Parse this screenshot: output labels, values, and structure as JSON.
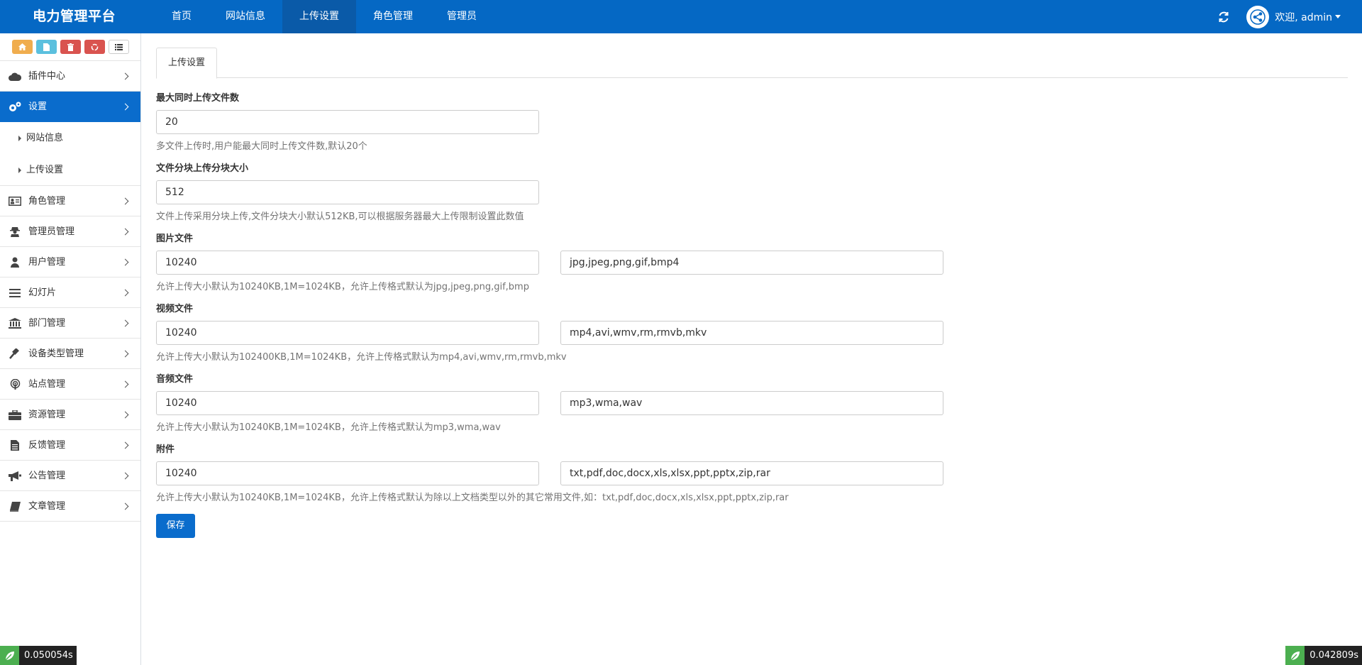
{
  "app": {
    "brand": "电力管理平台"
  },
  "topnav": [
    {
      "label": "首页"
    },
    {
      "label": "网站信息"
    },
    {
      "label": "上传设置",
      "active": true
    },
    {
      "label": "角色管理"
    },
    {
      "label": "管理员"
    }
  ],
  "user": {
    "greeting": "欢迎, admin"
  },
  "sidebar": {
    "quick_buttons": [
      {
        "icon": "home-icon",
        "color": "#f0ad4e"
      },
      {
        "icon": "file-icon",
        "color": "#5bc0de"
      },
      {
        "icon": "trash-icon",
        "color": "#d9534f"
      },
      {
        "icon": "recycle-icon",
        "color": "#d9534f"
      },
      {
        "icon": "list-icon",
        "color": "#ffffff"
      }
    ],
    "items": [
      {
        "label": "插件中心",
        "icon": "cloud-icon"
      },
      {
        "label": "设置",
        "icon": "gears-icon",
        "active": true,
        "children": [
          {
            "label": "网站信息"
          },
          {
            "label": "上传设置"
          }
        ]
      },
      {
        "label": "角色管理",
        "icon": "id-card-icon"
      },
      {
        "label": "管理员管理",
        "icon": "user-secret-icon"
      },
      {
        "label": "用户管理",
        "icon": "user-icon"
      },
      {
        "label": "幻灯片",
        "icon": "bars-icon"
      },
      {
        "label": "部门管理",
        "icon": "bank-icon"
      },
      {
        "label": "设备类型管理",
        "icon": "gavel-icon"
      },
      {
        "label": "站点管理",
        "icon": "podcast-icon"
      },
      {
        "label": "资源管理",
        "icon": "briefcase-icon"
      },
      {
        "label": "反馈管理",
        "icon": "file-text-icon"
      },
      {
        "label": "公告管理",
        "icon": "bullhorn-icon"
      },
      {
        "label": "文章管理",
        "icon": "book-icon"
      }
    ]
  },
  "main": {
    "tab": "上传设置",
    "fields": {
      "max_files": {
        "label": "最大同时上传文件数",
        "value": "20",
        "help": "多文件上传时,用户能最大同时上传文件数,默认20个"
      },
      "chunk_size": {
        "label": "文件分块上传分块大小",
        "value": "512",
        "help": "文件上传采用分块上传,文件分块大小默认512KB,可以根据服务器最大上传限制设置此数值"
      },
      "image": {
        "label": "图片文件",
        "size": "10240",
        "ext": "jpg,jpeg,png,gif,bmp4",
        "help": "允许上传大小默认为10240KB,1M=1024KB，允许上传格式默认为jpg,jpeg,png,gif,bmp"
      },
      "video": {
        "label": "视频文件",
        "size": "10240",
        "ext": "mp4,avi,wmv,rm,rmvb,mkv",
        "help": "允许上传大小默认为102400KB,1M=1024KB，允许上传格式默认为mp4,avi,wmv,rm,rmvb,mkv"
      },
      "audio": {
        "label": "音频文件",
        "size": "10240",
        "ext": "mp3,wma,wav",
        "help": "允许上传大小默认为10240KB,1M=1024KB，允许上传格式默认为mp3,wma,wav"
      },
      "attachment": {
        "label": "附件",
        "size": "10240",
        "ext": "txt,pdf,doc,docx,xls,xlsx,ppt,pptx,zip,rar",
        "help": "允许上传大小默认为10240KB,1M=1024KB，允许上传格式默认为除以上文档类型以外的其它常用文件,如：txt,pdf,doc,docx,xls,xlsx,ppt,pptx,zip,rar"
      }
    },
    "save_label": "保存"
  },
  "timers": {
    "left": "0.050054s",
    "right": "0.042809s"
  },
  "colors": {
    "primary": "#0568c4",
    "active": "#0a6ccc"
  }
}
